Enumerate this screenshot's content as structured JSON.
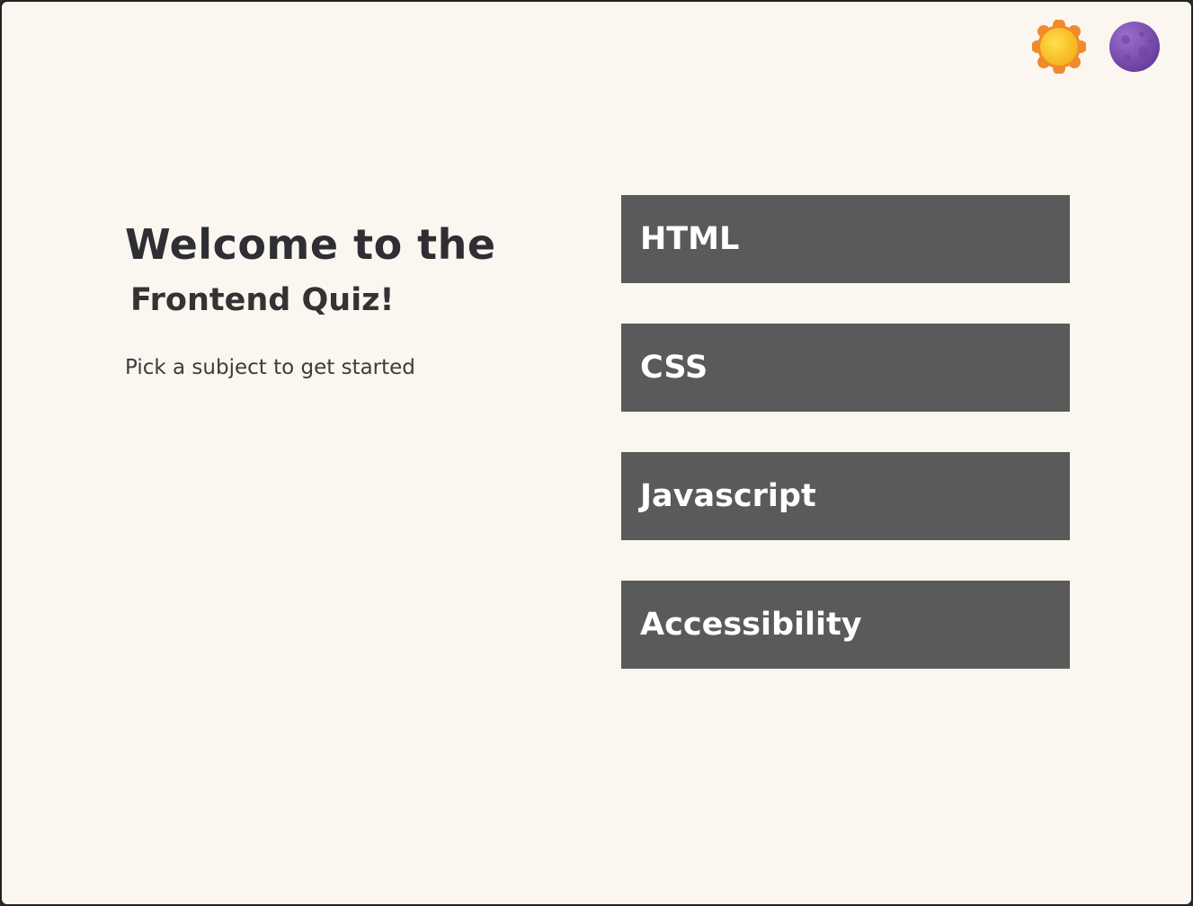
{
  "theme_toggle": {
    "light_icon": "sun-icon",
    "dark_icon": "moon-icon"
  },
  "intro": {
    "title_line1": "Welcome to the",
    "title_line2": "Frontend Quiz!",
    "subtitle": "Pick a subject to get started"
  },
  "subjects": [
    {
      "label": "HTML"
    },
    {
      "label": "CSS"
    },
    {
      "label": "Javascript"
    },
    {
      "label": "Accessibility"
    }
  ],
  "colors": {
    "background": "#fbf6ef",
    "button": "#5a5a5a",
    "button_text": "#ffffff",
    "text": "#2e2e33",
    "sun": "#f7c22a",
    "moon": "#7a4fb0"
  }
}
